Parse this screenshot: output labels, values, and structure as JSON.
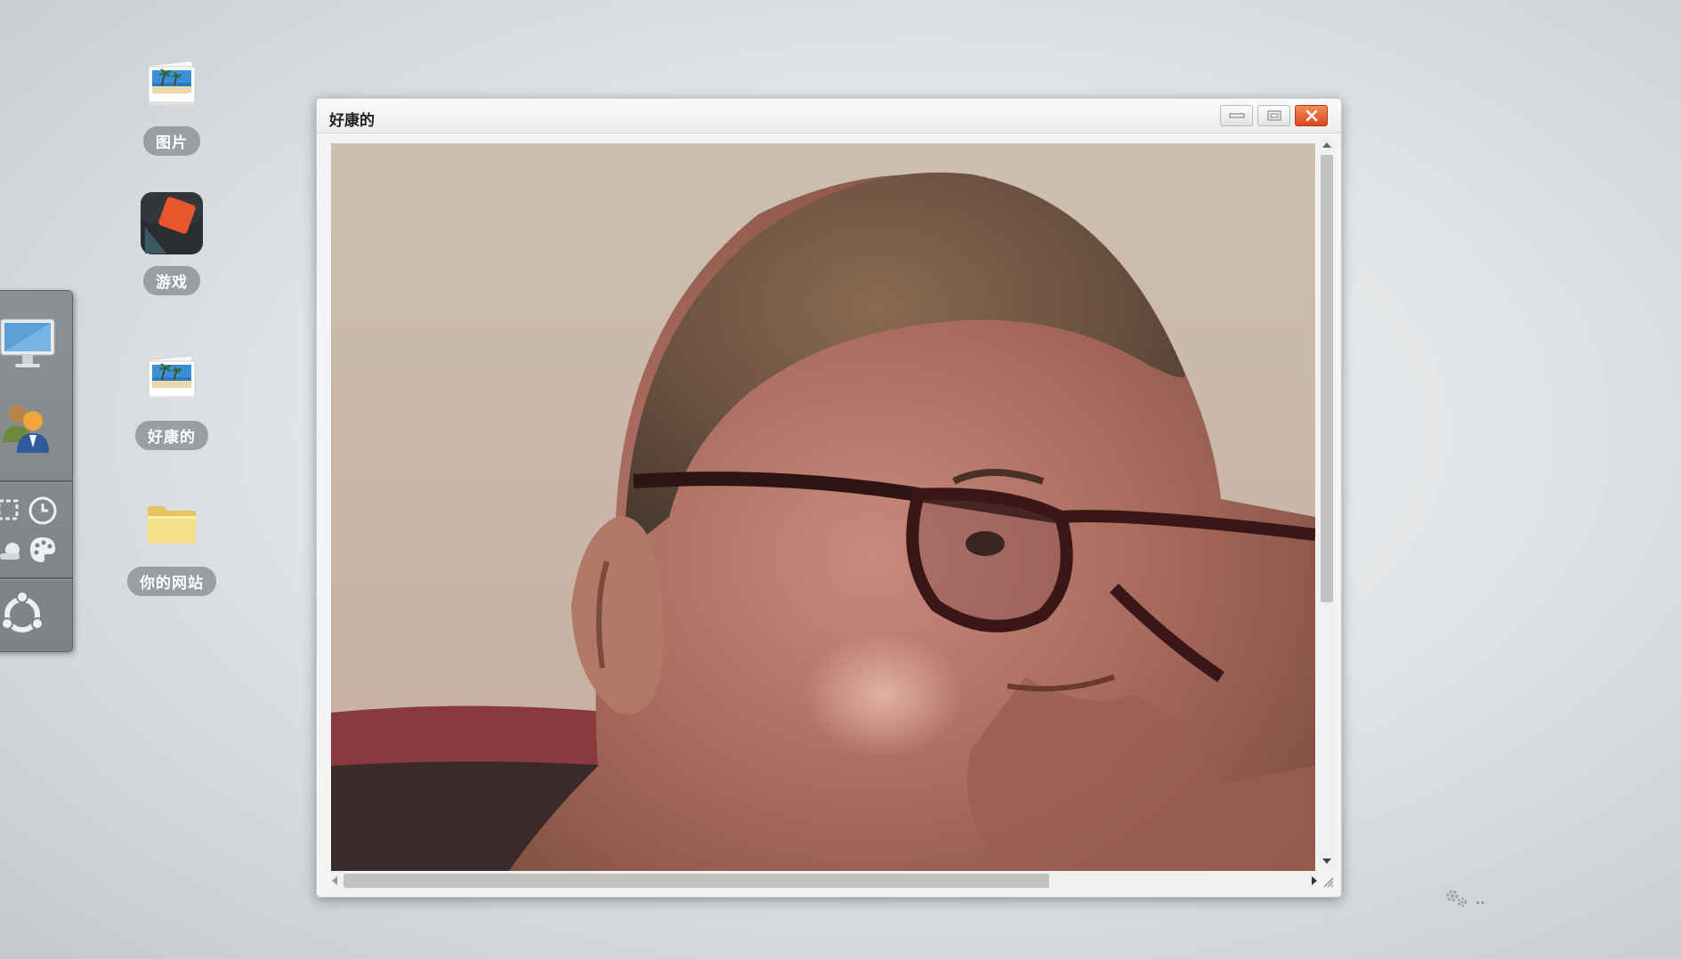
{
  "desktop": {
    "icons": [
      {
        "label": "图片",
        "icon": "photo-icon"
      },
      {
        "label": "游戏",
        "icon": "game-icon"
      },
      {
        "label": "好康的",
        "icon": "photo-icon"
      },
      {
        "label": "你的网站",
        "icon": "folder-icon"
      }
    ]
  },
  "dock": {
    "items": [
      "monitor-icon",
      "users-icon",
      "screenshot-icon",
      "clock-icon",
      "weather-icon",
      "palette-icon",
      "ubuntu-icon"
    ]
  },
  "window": {
    "title": "好康的",
    "buttons": [
      "minimize",
      "maximize",
      "close"
    ],
    "content": "photo of a bald man wearing dark-framed glasses"
  },
  "tray": {
    "icon": "gears-icon",
    "dots": ".."
  },
  "colors": {
    "close_button": "#e05a2b",
    "label_pill": "#8c949a",
    "dock": "#868a8d"
  }
}
